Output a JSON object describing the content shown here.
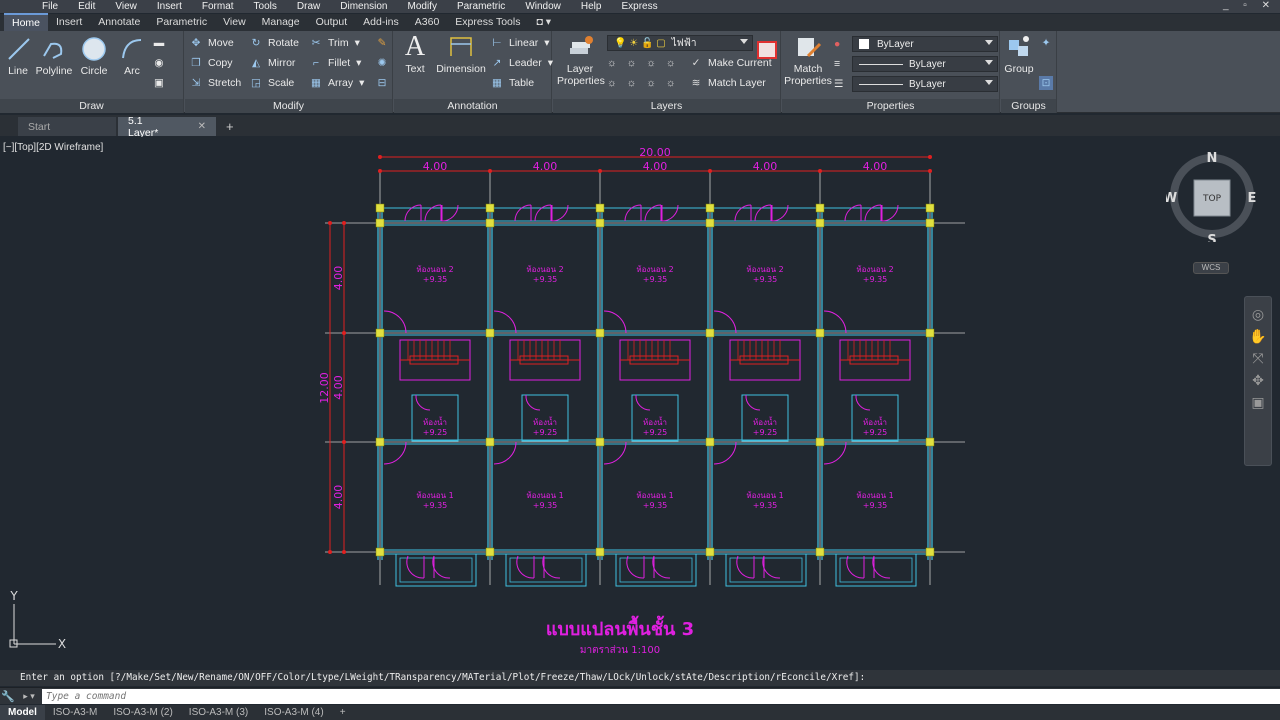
{
  "menubar": {
    "items": [
      "File",
      "Edit",
      "View",
      "Insert",
      "Format",
      "Tools",
      "Draw",
      "Dimension",
      "Modify",
      "Parametric",
      "Window",
      "Help",
      "Express"
    ],
    "window_controls": "_ ▫ ✕"
  },
  "ribbon_tabs": [
    {
      "label": "Home",
      "active": true
    },
    {
      "label": "Insert"
    },
    {
      "label": "Annotate"
    },
    {
      "label": "Parametric"
    },
    {
      "label": "View"
    },
    {
      "label": "Manage"
    },
    {
      "label": "Output"
    },
    {
      "label": "Add-ins"
    },
    {
      "label": "A360"
    },
    {
      "label": "Express Tools"
    },
    {
      "label": "◘ ▾"
    }
  ],
  "draw_panel": {
    "title": "Draw",
    "line": "Line",
    "polyline": "Polyline",
    "circle": "Circle",
    "arc": "Arc"
  },
  "modify_panel": {
    "title": "Modify",
    "move": "Move",
    "rotate": "Rotate",
    "trim": "Trim",
    "copy": "Copy",
    "mirror": "Mirror",
    "fillet": "Fillet",
    "stretch": "Stretch",
    "scale": "Scale",
    "array": "Array"
  },
  "annotation_panel": {
    "title": "Annotation",
    "text": "Text",
    "dimension": "Dimension",
    "linear": "Linear",
    "leader": "Leader",
    "table": "Table"
  },
  "layers_panel": {
    "title": "Layers",
    "layer_properties_1": "Layer",
    "layer_properties_2": "Properties",
    "current_layer": "ไฟฟ้า",
    "make_current": "Make Current",
    "match_layer": "Match Layer"
  },
  "properties_panel": {
    "title": "Properties",
    "match_1": "Match",
    "match_2": "Properties",
    "color": "ByLayer",
    "linetype": "ByLayer",
    "lineweight": "ByLayer"
  },
  "groups_panel": {
    "title": "Groups",
    "group": "Group"
  },
  "doc_tabs": [
    {
      "label": "Start"
    },
    {
      "label": "5.1 Layer*",
      "active": true
    }
  ],
  "viewport_label": "[−][Top][2D Wireframe]",
  "drawing": {
    "overall_width": "20.00",
    "bay_widths": [
      "4.00",
      "4.00",
      "4.00",
      "4.00",
      "4.00"
    ],
    "overall_depth": "12.00",
    "row_depths": [
      "4.00",
      "4.00",
      "4.00"
    ],
    "bedroom_2": "ห้องนอน 2",
    "bedroom_1": "ห้องนอน 1",
    "bathroom": "ห้องน้ำ",
    "level_room": "+9.35",
    "level_bath": "+9.25",
    "title": "แบบแปลนพื้นชั้น 3",
    "scale": "มาตราส่วน 1:100"
  },
  "navcube": {
    "n": "N",
    "s": "S",
    "e": "E",
    "w": "W",
    "top": "TOP",
    "wcs": "WCS"
  },
  "ucs": {
    "x": "X",
    "y": "Y"
  },
  "command": {
    "history": "Enter an option [?/Make/Set/New/Rename/ON/OFF/Color/Ltype/LWeight/TRansparency/MATerial/Plot/Freeze/Thaw/LOck/Unlock/stAte/Description/rEconcile/Xref]:",
    "placeholder": "Type a command",
    "prompt_icon": "▸ ▾"
  },
  "layout_tabs": [
    {
      "label": "Model",
      "active": true
    },
    {
      "label": "ISO-A3-M"
    },
    {
      "label": "ISO-A3-M (2)"
    },
    {
      "label": "ISO-A3-M (3)"
    },
    {
      "label": "ISO-A3-M (4)"
    },
    {
      "label": "+"
    }
  ],
  "colors": {
    "magenta": "#e020e0",
    "cyan": "#40c0e0",
    "red": "#e02020",
    "yellow": "#e0e040",
    "background": "#212830"
  }
}
